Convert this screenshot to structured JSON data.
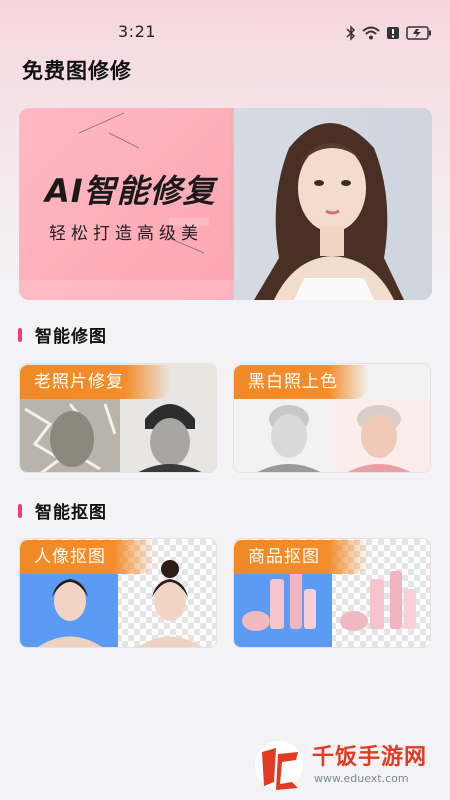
{
  "status_bar": {
    "time": "3:21",
    "icons": [
      "bluetooth-icon",
      "wifi-icon",
      "alert-icon",
      "battery-icon"
    ]
  },
  "app": {
    "title": "免费图修修"
  },
  "banner": {
    "title": "AI智能修复",
    "subtitle": "轻松打造高级美"
  },
  "sections": [
    {
      "title": "智能修图",
      "cards": [
        {
          "label": "老照片修复"
        },
        {
          "label": "黑白照上色"
        }
      ]
    },
    {
      "title": "智能抠图",
      "cards": [
        {
          "label": "人像抠图"
        },
        {
          "label": "商品抠图"
        }
      ]
    }
  ],
  "watermark": {
    "name": "千饭手游网",
    "url": "www.eduext.com"
  },
  "colors": {
    "accent": "#ef3f72",
    "tag": "#f08a26",
    "banner": "#fdabb7"
  }
}
